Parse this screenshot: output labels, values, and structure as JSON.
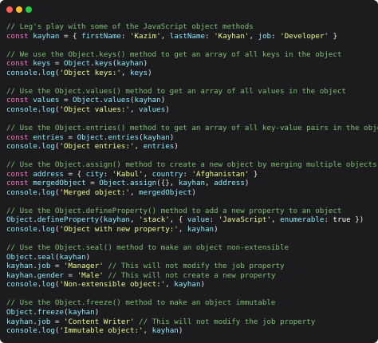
{
  "window": {
    "controls": [
      "close",
      "minimize",
      "maximize"
    ],
    "colors": {
      "background": "#1c1c1e",
      "close": "#ff5f56",
      "minimize": "#ffbd2e",
      "maximize": "#27c93f",
      "comment": "#7fbf73",
      "keyword": "#ff79c6",
      "identifier": "#8be9fd",
      "string": "#f1fa8c",
      "punctuation": "#e6e6e6"
    }
  },
  "code": {
    "lines": [
      {
        "comment": "// Leg's play with some of the JavaScript object methods"
      },
      {
        "tokens": [
          [
            "kw",
            "const"
          ],
          [
            "p",
            " "
          ],
          [
            "id",
            "kayhan"
          ],
          [
            "p",
            " = { "
          ],
          [
            "id",
            "firstName"
          ],
          [
            "p",
            ": "
          ],
          [
            "str",
            "'Kazim'"
          ],
          [
            "p",
            ", "
          ],
          [
            "id",
            "lastName"
          ],
          [
            "p",
            ": "
          ],
          [
            "str",
            "'Kayhan'"
          ],
          [
            "p",
            ", "
          ],
          [
            "id",
            "job"
          ],
          [
            "p",
            ": "
          ],
          [
            "str",
            "'Developer'"
          ],
          [
            "p",
            " }"
          ]
        ]
      },
      {
        "blank": true
      },
      {
        "comment": "// We use the Object.keys() method to get an array of all keys in the object"
      },
      {
        "tokens": [
          [
            "kw",
            "const"
          ],
          [
            "p",
            " "
          ],
          [
            "id",
            "keys"
          ],
          [
            "p",
            " = "
          ],
          [
            "id",
            "Object"
          ],
          [
            "p",
            "."
          ],
          [
            "id",
            "keys"
          ],
          [
            "p",
            "("
          ],
          [
            "id",
            "kayhan"
          ],
          [
            "p",
            ")"
          ]
        ]
      },
      {
        "tokens": [
          [
            "id",
            "console"
          ],
          [
            "p",
            "."
          ],
          [
            "id",
            "log"
          ],
          [
            "p",
            "("
          ],
          [
            "str",
            "'Object keys:'"
          ],
          [
            "p",
            ", "
          ],
          [
            "id",
            "keys"
          ],
          [
            "p",
            ")"
          ]
        ]
      },
      {
        "blank": true
      },
      {
        "comment": "// Use the Object.values() method to get an array of all values in the object"
      },
      {
        "tokens": [
          [
            "kw",
            "const"
          ],
          [
            "p",
            " "
          ],
          [
            "id",
            "values"
          ],
          [
            "p",
            " = "
          ],
          [
            "id",
            "Object"
          ],
          [
            "p",
            "."
          ],
          [
            "id",
            "values"
          ],
          [
            "p",
            "("
          ],
          [
            "id",
            "kayhan"
          ],
          [
            "p",
            ")"
          ]
        ]
      },
      {
        "tokens": [
          [
            "id",
            "console"
          ],
          [
            "p",
            "."
          ],
          [
            "id",
            "log"
          ],
          [
            "p",
            "("
          ],
          [
            "str",
            "'Object values:'"
          ],
          [
            "p",
            ", "
          ],
          [
            "id",
            "values"
          ],
          [
            "p",
            ")"
          ]
        ]
      },
      {
        "blank": true
      },
      {
        "comment": "// Use the Object.entries() method to get an array of all key-value pairs in the object"
      },
      {
        "tokens": [
          [
            "kw",
            "const"
          ],
          [
            "p",
            " "
          ],
          [
            "id",
            "entries"
          ],
          [
            "p",
            " = "
          ],
          [
            "id",
            "Object"
          ],
          [
            "p",
            "."
          ],
          [
            "id",
            "entries"
          ],
          [
            "p",
            "("
          ],
          [
            "id",
            "kayhan"
          ],
          [
            "p",
            ")"
          ]
        ]
      },
      {
        "tokens": [
          [
            "id",
            "console"
          ],
          [
            "p",
            "."
          ],
          [
            "id",
            "log"
          ],
          [
            "p",
            "("
          ],
          [
            "str",
            "'Object entries:'"
          ],
          [
            "p",
            ", "
          ],
          [
            "id",
            "entries"
          ],
          [
            "p",
            ")"
          ]
        ]
      },
      {
        "blank": true
      },
      {
        "comment": "// Use the Object.assign() method to create a new object by merging multiple objects"
      },
      {
        "tokens": [
          [
            "kw",
            "const"
          ],
          [
            "p",
            " "
          ],
          [
            "id",
            "address"
          ],
          [
            "p",
            " = { "
          ],
          [
            "id",
            "city"
          ],
          [
            "p",
            ": "
          ],
          [
            "str",
            "'Kabul'"
          ],
          [
            "p",
            ", "
          ],
          [
            "id",
            "country"
          ],
          [
            "p",
            ": "
          ],
          [
            "str",
            "'Afghanistan'"
          ],
          [
            "p",
            " }"
          ]
        ]
      },
      {
        "tokens": [
          [
            "kw",
            "const"
          ],
          [
            "p",
            " "
          ],
          [
            "id",
            "mergedObject"
          ],
          [
            "p",
            " = "
          ],
          [
            "id",
            "Object"
          ],
          [
            "p",
            "."
          ],
          [
            "id",
            "assign"
          ],
          [
            "p",
            "({}, "
          ],
          [
            "id",
            "kayhan"
          ],
          [
            "p",
            ", "
          ],
          [
            "id",
            "address"
          ],
          [
            "p",
            ")"
          ]
        ]
      },
      {
        "tokens": [
          [
            "id",
            "console"
          ],
          [
            "p",
            "."
          ],
          [
            "id",
            "log"
          ],
          [
            "p",
            "("
          ],
          [
            "str",
            "'Merged object:'"
          ],
          [
            "p",
            ", "
          ],
          [
            "id",
            "mergedObject"
          ],
          [
            "p",
            ")"
          ]
        ]
      },
      {
        "blank": true
      },
      {
        "comment": "// Use the Object.defineProperty() method to add a new property to an object"
      },
      {
        "tokens": [
          [
            "id",
            "Object"
          ],
          [
            "p",
            "."
          ],
          [
            "id",
            "defineProperty"
          ],
          [
            "p",
            "("
          ],
          [
            "id",
            "kayhan"
          ],
          [
            "p",
            ", "
          ],
          [
            "str",
            "'stack'"
          ],
          [
            "p",
            ", { "
          ],
          [
            "id",
            "value"
          ],
          [
            "p",
            ": "
          ],
          [
            "str",
            "'JavaScript'"
          ],
          [
            "p",
            ", "
          ],
          [
            "id",
            "enumerable"
          ],
          [
            "p",
            ": "
          ],
          [
            "lit",
            "true"
          ],
          [
            "p",
            " })"
          ]
        ]
      },
      {
        "tokens": [
          [
            "id",
            "console"
          ],
          [
            "p",
            "."
          ],
          [
            "id",
            "log"
          ],
          [
            "p",
            "("
          ],
          [
            "str",
            "'Object with new property:'"
          ],
          [
            "p",
            ", "
          ],
          [
            "id",
            "kayhan"
          ],
          [
            "p",
            ")"
          ]
        ]
      },
      {
        "blank": true
      },
      {
        "comment": "// Use the Object.seal() method to make an object non-extensible"
      },
      {
        "tokens": [
          [
            "id",
            "Object"
          ],
          [
            "p",
            "."
          ],
          [
            "id",
            "seal"
          ],
          [
            "p",
            "("
          ],
          [
            "id",
            "kayhan"
          ],
          [
            "p",
            ")"
          ]
        ]
      },
      {
        "tokens": [
          [
            "id",
            "kayhan"
          ],
          [
            "p",
            "."
          ],
          [
            "id",
            "job"
          ],
          [
            "p",
            " = "
          ],
          [
            "str",
            "'Manager'"
          ],
          [
            "p",
            " "
          ],
          [
            "comment",
            "// This will not modify the job property"
          ]
        ]
      },
      {
        "tokens": [
          [
            "id",
            "kayhan"
          ],
          [
            "p",
            "."
          ],
          [
            "id",
            "gender"
          ],
          [
            "p",
            " = "
          ],
          [
            "str",
            "'Male'"
          ],
          [
            "p",
            " "
          ],
          [
            "comment",
            "// This will not create a new property"
          ]
        ]
      },
      {
        "tokens": [
          [
            "id",
            "console"
          ],
          [
            "p",
            "."
          ],
          [
            "id",
            "log"
          ],
          [
            "p",
            "("
          ],
          [
            "str",
            "'Non-extensible object:'"
          ],
          [
            "p",
            ", "
          ],
          [
            "id",
            "kayhan"
          ],
          [
            "p",
            ")"
          ]
        ]
      },
      {
        "blank": true
      },
      {
        "comment": "// Use the Object.freeze() method to make an object immutable"
      },
      {
        "tokens": [
          [
            "id",
            "Object"
          ],
          [
            "p",
            "."
          ],
          [
            "id",
            "freeze"
          ],
          [
            "p",
            "("
          ],
          [
            "id",
            "kayhan"
          ],
          [
            "p",
            ")"
          ]
        ]
      },
      {
        "tokens": [
          [
            "id",
            "kayhan"
          ],
          [
            "p",
            "."
          ],
          [
            "id",
            "job"
          ],
          [
            "p",
            " = "
          ],
          [
            "str",
            "'Content Writer'"
          ],
          [
            "p",
            " "
          ],
          [
            "comment",
            "// This will not modify the job property"
          ]
        ]
      },
      {
        "tokens": [
          [
            "id",
            "console"
          ],
          [
            "p",
            "."
          ],
          [
            "id",
            "log"
          ],
          [
            "p",
            "("
          ],
          [
            "str",
            "'Immutable object:'"
          ],
          [
            "p",
            ", "
          ],
          [
            "id",
            "kayhan"
          ],
          [
            "p",
            ")"
          ]
        ]
      }
    ]
  }
}
